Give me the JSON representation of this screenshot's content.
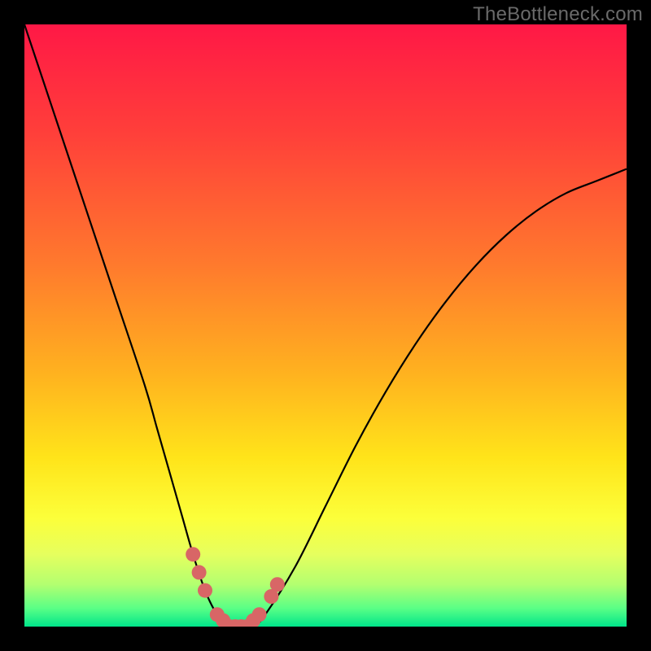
{
  "watermark": "TheBottleneck.com",
  "colors": {
    "frame_background": "#000000",
    "curve_stroke": "#000000",
    "marker_fill": "#d86666",
    "marker_stroke": "#b44d4d",
    "gradient_stops": [
      {
        "offset": 0.0,
        "color": "#ff1846"
      },
      {
        "offset": 0.18,
        "color": "#ff3f3a"
      },
      {
        "offset": 0.4,
        "color": "#ff7a2d"
      },
      {
        "offset": 0.58,
        "color": "#ffb21f"
      },
      {
        "offset": 0.72,
        "color": "#ffe41a"
      },
      {
        "offset": 0.82,
        "color": "#fcff3a"
      },
      {
        "offset": 0.88,
        "color": "#e6ff5e"
      },
      {
        "offset": 0.93,
        "color": "#b3ff70"
      },
      {
        "offset": 0.97,
        "color": "#59ff86"
      },
      {
        "offset": 1.0,
        "color": "#00e58a"
      }
    ]
  },
  "chart_data": {
    "type": "line",
    "x": [
      0,
      5,
      10,
      15,
      20,
      22,
      24,
      26,
      28,
      30,
      32,
      34,
      36,
      38,
      40,
      45,
      50,
      55,
      60,
      65,
      70,
      75,
      80,
      85,
      90,
      95,
      100
    ],
    "y": [
      100,
      85,
      70,
      55,
      40,
      33,
      26,
      19,
      12,
      6,
      2,
      0,
      0,
      0,
      2,
      10,
      20,
      30,
      39,
      47,
      54,
      60,
      65,
      69,
      72,
      74,
      76
    ],
    "title": "",
    "xlabel": "",
    "ylabel": "",
    "xlim": [
      0,
      100
    ],
    "ylim": [
      0,
      100
    ],
    "markers": [
      {
        "x": 28,
        "y": 12
      },
      {
        "x": 29,
        "y": 9
      },
      {
        "x": 30,
        "y": 6
      },
      {
        "x": 32,
        "y": 2
      },
      {
        "x": 33,
        "y": 1
      },
      {
        "x": 34,
        "y": 0
      },
      {
        "x": 35,
        "y": 0
      },
      {
        "x": 36,
        "y": 0
      },
      {
        "x": 37,
        "y": 0
      },
      {
        "x": 38,
        "y": 1
      },
      {
        "x": 39,
        "y": 2
      },
      {
        "x": 41,
        "y": 5
      },
      {
        "x": 42,
        "y": 7
      }
    ]
  }
}
